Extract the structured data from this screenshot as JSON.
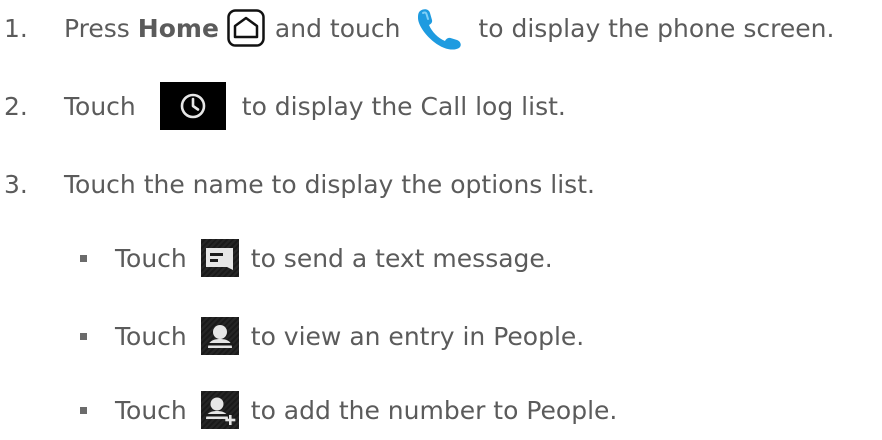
{
  "steps": [
    {
      "number": "1.",
      "parts": [
        "Press",
        "Home",
        "and touch",
        "to display the phone screen."
      ]
    },
    {
      "number": "2.",
      "parts": [
        "Touch",
        "to display the Call log list."
      ]
    },
    {
      "number": "3.",
      "parts": [
        "Touch the name to display the options list."
      ]
    }
  ],
  "options": [
    {
      "before": "Touch",
      "after": "to send a text message."
    },
    {
      "before": "Touch",
      "after": "to view an entry in People."
    },
    {
      "before": "Touch",
      "after": "to add the number to People."
    }
  ],
  "icons": {
    "home": "home-key-icon",
    "phone": "phone-icon",
    "call_log": "call-log-clock-icon",
    "message": "text-message-icon",
    "person": "person-icon",
    "person_add": "add-person-icon"
  },
  "colors": {
    "text": "#5b5b5b",
    "phone_icon": "#1e9be0",
    "tile_dark": "#000000"
  }
}
